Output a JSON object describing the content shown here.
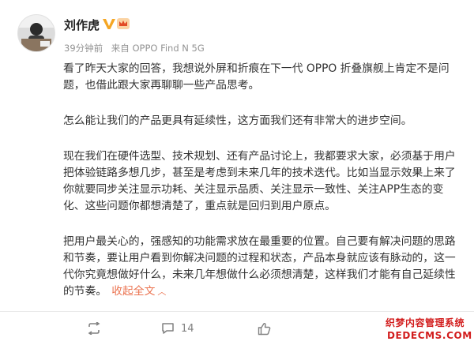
{
  "author": {
    "name": "刘作虎",
    "verify_icon": "verified-v-badge",
    "member_icon": "member-crown-icon"
  },
  "meta": {
    "time": "39分钟前",
    "source": "来自 OPPO Find N 5G"
  },
  "post": {
    "paragraphs": [
      "看了昨天大家的回答，我想说外屏和折痕在下一代 OPPO 折叠旗舰上肯定不是问题，也借此跟大家再聊聊一些产品思考。",
      "怎么能让我们的产品更具有延续性，这方面我们还有非常大的进步空间。",
      "现在我们在硬件选型、技术规划、还有产品讨论上，我都要求大家，必须基于用户把体验链路多想几步，甚至是考虑到未来几年的技术迭代。比如当显示效果上来了你就要同步关注显示功耗、关注显示品质、关注显示一致性、关注APP生态的变化、这些问题你都想清楚了，重点就是回归到用户原点。",
      "把用户最关心的，强感知的功能需求放在最重要的位置。自己要有解决问题的思路和节奏，要让用户看到你解决问题的过程和状态，产品本身就应该有脉动的，这一代你究竟想做好什么，未来几年想做什么必须想清楚，这样我们才能有自己延续性的节奏。"
    ],
    "collapse_label": "收起全文",
    "collapse_icon": "chevron-up-icon"
  },
  "actions": {
    "repost_icon": "repost-icon",
    "comment_icon": "comment-icon",
    "comment_count": "14",
    "like_icon": "thumbs-up-icon"
  },
  "watermark": {
    "line1": "织梦内容管理系统",
    "line2": "DEDECMS.COM"
  },
  "colors": {
    "text": "#333333",
    "meta": "#939393",
    "accent": "#eb7350",
    "verify": "#f5a623",
    "watermark": "#d21d1d"
  }
}
